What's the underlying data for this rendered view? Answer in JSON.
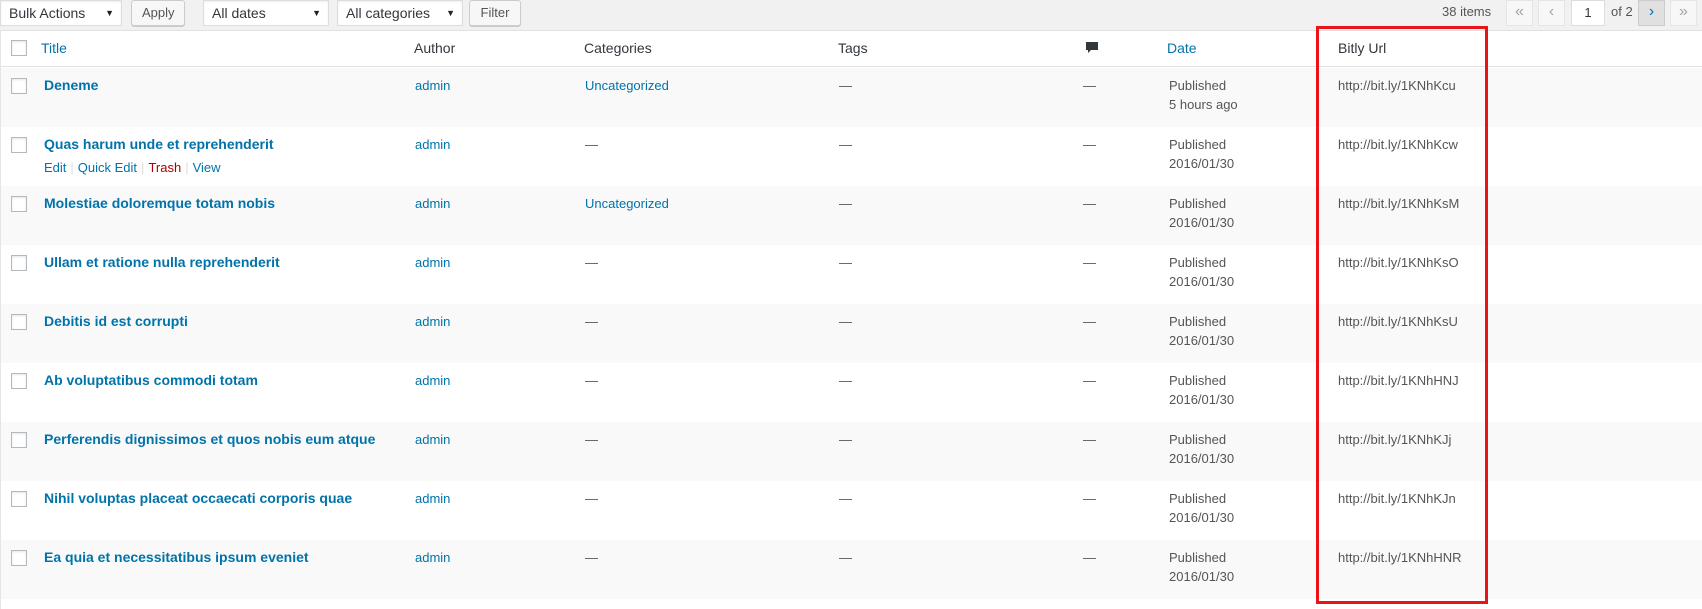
{
  "toolbar": {
    "bulk_actions": "Bulk Actions",
    "apply": "Apply",
    "dates": "All dates",
    "categories": "All categories",
    "filter": "Filter"
  },
  "pagination": {
    "count": "38 items",
    "first": "«",
    "prev": "‹",
    "current_page": "1",
    "of": "of 2",
    "next": "›",
    "last": "»"
  },
  "columns": {
    "title": "Title",
    "author": "Author",
    "categories": "Categories",
    "tags": "Tags",
    "comments_icon": "comment-icon",
    "date": "Date",
    "bitly": "Bitly Url"
  },
  "row_actions": {
    "edit": "Edit",
    "quick_edit": "Quick Edit",
    "trash": "Trash",
    "view": "View"
  },
  "rows": [
    {
      "title": "Deneme",
      "author": "admin",
      "categories": "Uncategorized",
      "tags": "—",
      "comments": "—",
      "status": "Published",
      "date": "5 hours ago",
      "url": "http://bit.ly/1KNhKcu"
    },
    {
      "title": "Quas harum unde et reprehenderit",
      "author": "admin",
      "categories": "—",
      "tags": "—",
      "comments": "—",
      "status": "Published",
      "date": "2016/01/30",
      "url": "http://bit.ly/1KNhKcw"
    },
    {
      "title": "Molestiae doloremque totam nobis",
      "author": "admin",
      "categories": "Uncategorized",
      "tags": "—",
      "comments": "—",
      "status": "Published",
      "date": "2016/01/30",
      "url": "http://bit.ly/1KNhKsM"
    },
    {
      "title": "Ullam et ratione nulla reprehenderit",
      "author": "admin",
      "categories": "—",
      "tags": "—",
      "comments": "—",
      "status": "Published",
      "date": "2016/01/30",
      "url": "http://bit.ly/1KNhKsO"
    },
    {
      "title": "Debitis id est corrupti",
      "author": "admin",
      "categories": "—",
      "tags": "—",
      "comments": "—",
      "status": "Published",
      "date": "2016/01/30",
      "url": "http://bit.ly/1KNhKsU"
    },
    {
      "title": "Ab voluptatibus commodi totam",
      "author": "admin",
      "categories": "—",
      "tags": "—",
      "comments": "—",
      "status": "Published",
      "date": "2016/01/30",
      "url": "http://bit.ly/1KNhHNJ"
    },
    {
      "title": "Perferendis dignissimos et quos nobis eum atque",
      "author": "admin",
      "categories": "—",
      "tags": "—",
      "comments": "—",
      "status": "Published",
      "date": "2016/01/30",
      "url": "http://bit.ly/1KNhKJj"
    },
    {
      "title": "Nihil voluptas placeat occaecati corporis quae",
      "author": "admin",
      "categories": "—",
      "tags": "—",
      "comments": "—",
      "status": "Published",
      "date": "2016/01/30",
      "url": "http://bit.ly/1KNhKJn"
    },
    {
      "title": "Ea quia et necessitatibus ipsum eveniet",
      "author": "admin",
      "categories": "—",
      "tags": "—",
      "comments": "—",
      "status": "Published",
      "date": "2016/01/30",
      "url": "http://bit.ly/1KNhHNR"
    }
  ],
  "highlight_color": "#e8141a"
}
